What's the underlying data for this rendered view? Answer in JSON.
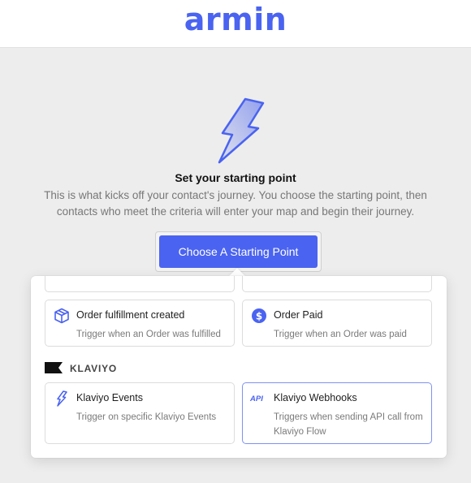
{
  "header": {
    "logo_text": "armin"
  },
  "hero": {
    "icon": "lightning-bolt-icon",
    "title": "Set your starting point",
    "description": "This is what kicks off your contact's journey. You choose the starting point, then contacts who meet the criteria will enter your map and begin their journey."
  },
  "cta": {
    "label": "Choose A Starting Point"
  },
  "dropdown": {
    "cards_top": [
      {
        "icon": "package-box-icon",
        "title": "Order fulfillment created",
        "subtitle": "Trigger when an Order was fulfilled"
      },
      {
        "icon": "dollar-circle-icon",
        "title": "Order Paid",
        "subtitle": "Trigger when an Order was paid"
      }
    ],
    "section": {
      "icon": "klaviyo-flag-icon",
      "label": "KLAVIYO"
    },
    "cards_bottom": [
      {
        "icon": "lightning-icon",
        "title": "Klaviyo Events",
        "subtitle": "Trigger on specific Klaviyo Events"
      },
      {
        "icon": "api-icon",
        "icon_text": "API",
        "title": "Klaviyo Webhooks",
        "subtitle": "Triggers when sending API call from Klaviyo Flow"
      }
    ]
  },
  "colors": {
    "accent": "#4a63f0",
    "background": "#ededed",
    "selected_border": "#7f92f2"
  }
}
